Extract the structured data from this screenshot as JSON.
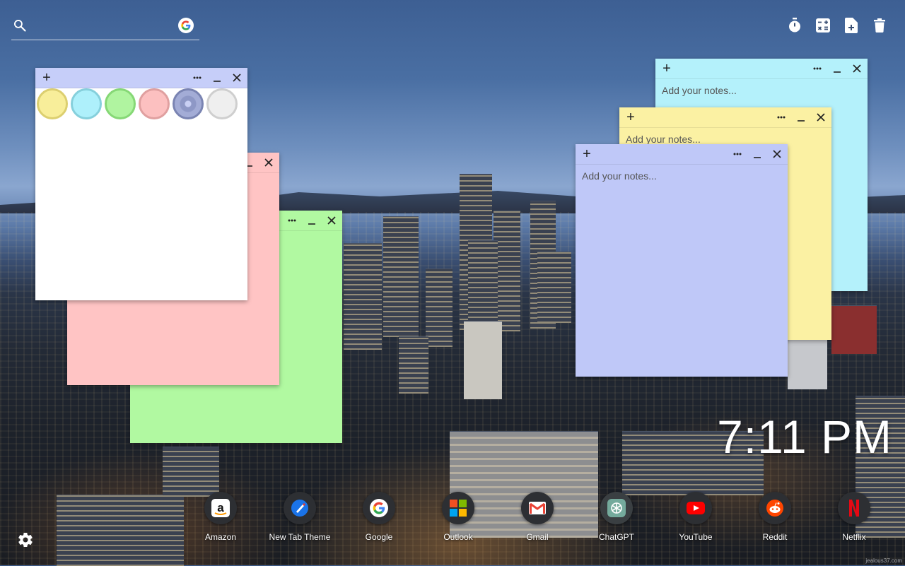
{
  "search": {
    "placeholder": "",
    "value": "",
    "engine_icon": "google-icon"
  },
  "toolbar": {
    "items": [
      "timer-icon",
      "calculator-icon",
      "add-note-icon",
      "trash-icon"
    ]
  },
  "notes": {
    "white": {
      "color": "#ffffff",
      "placeholder": ""
    },
    "pink": {
      "color": "#ffc4c4"
    },
    "green": {
      "color": "#b1f9a1"
    },
    "cyan": {
      "color": "#b4f1fb",
      "placeholder": "Add your notes..."
    },
    "yellow": {
      "color": "#fbf1a3",
      "placeholder": "Add your notes..."
    },
    "blue": {
      "color": "#bfc8f8",
      "placeholder": "Add your notes..."
    }
  },
  "palette": [
    {
      "name": "yellow",
      "fill": "#f8ee9a",
      "ring": "#dccf70"
    },
    {
      "name": "cyan",
      "fill": "#aef0fb",
      "ring": "#86d0dc"
    },
    {
      "name": "green",
      "fill": "#b0f4a0",
      "ring": "#86d876"
    },
    {
      "name": "pink",
      "fill": "#fcc0c0",
      "ring": "#e0a0a0"
    },
    {
      "name": "blue",
      "fill": "#8e98c6",
      "ring": "#7a84b2",
      "selected": true
    },
    {
      "name": "white",
      "fill": "#efefef",
      "ring": "#cfcfcf"
    }
  ],
  "clock": {
    "time": "7:11 PM"
  },
  "dock": [
    {
      "label": "Amazon",
      "icon": "amazon-icon"
    },
    {
      "label": "New Tab Theme",
      "icon": "new-tab-theme-icon"
    },
    {
      "label": "Google",
      "icon": "google-icon"
    },
    {
      "label": "Outlook",
      "icon": "outlook-icon"
    },
    {
      "label": "Gmail",
      "icon": "gmail-icon"
    },
    {
      "label": "ChatGPT",
      "icon": "chatgpt-icon"
    },
    {
      "label": "YouTube",
      "icon": "youtube-icon"
    },
    {
      "label": "Reddit",
      "icon": "reddit-icon"
    },
    {
      "label": "Netflix",
      "icon": "netflix-icon"
    }
  ],
  "credit": "jealous37.com"
}
